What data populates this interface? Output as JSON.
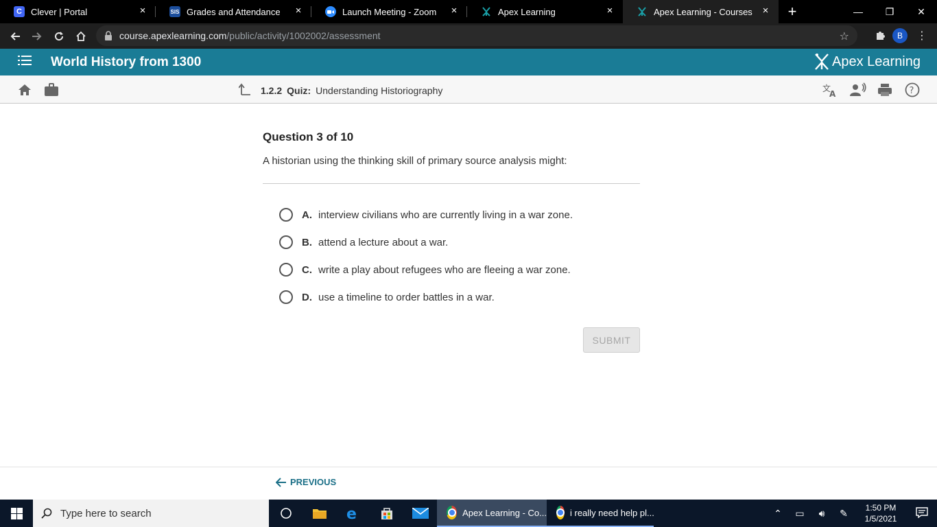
{
  "browser": {
    "tabs": [
      {
        "title": "Clever | Portal",
        "favicon": "C",
        "color": "#4166f5"
      },
      {
        "title": "Grades and Attendance",
        "favicon": "SIS",
        "color": "#1c4e9c"
      },
      {
        "title": "Launch Meeting - Zoom",
        "favicon": "zoom-icon",
        "color": "#2d8cff"
      },
      {
        "title": "Apex Learning",
        "favicon": "apex-icon",
        "color": "#19a0a8"
      },
      {
        "title": "Apex Learning - Courses",
        "favicon": "apex-icon",
        "color": "#19a0a8"
      }
    ],
    "url_host": "course.apexlearning.com",
    "url_path": "/public/activity/1002002/assessment",
    "profile_initial": "B"
  },
  "header": {
    "course_title": "World History from 1300",
    "logo_text": "Apex Learning",
    "color": "#1a7c96"
  },
  "toolbar": {
    "activity_number": "1.2.2",
    "activity_type": "Quiz:",
    "activity_name": "Understanding Historiography"
  },
  "question": {
    "header": "Question 3 of 10",
    "prompt": "A historian using the thinking skill of primary source analysis might:",
    "choices": [
      {
        "letter": "A.",
        "text": "interview civilians who are currently living in a war zone."
      },
      {
        "letter": "B.",
        "text": "attend a lecture about a war."
      },
      {
        "letter": "C.",
        "text": "write a play about refugees who are fleeing a war zone."
      },
      {
        "letter": "D.",
        "text": "use a timeline to order battles in a war."
      }
    ],
    "submit_label": "SUBMIT"
  },
  "footer": {
    "previous_label": "PREVIOUS"
  },
  "taskbar": {
    "search_placeholder": "Type here to search",
    "apps": [
      {
        "title": "Apex Learning - Co...",
        "active": true
      },
      {
        "title": "i really need help pl...",
        "active": false
      }
    ],
    "time": "1:50 PM",
    "date": "1/5/2021"
  }
}
